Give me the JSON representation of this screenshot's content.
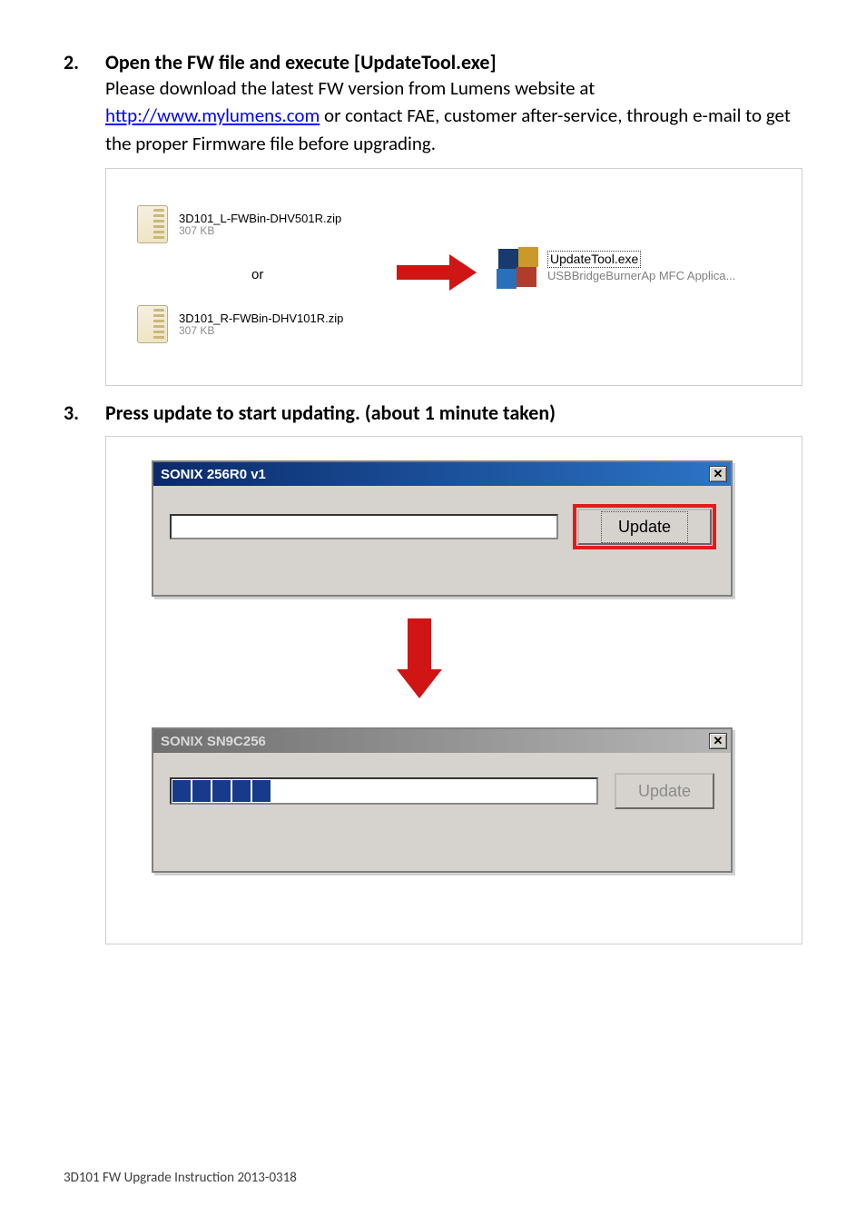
{
  "step2": {
    "num": "2.",
    "title": "Open the FW file and execute [UpdateTool.exe]",
    "body_pre": "Please download the latest FW version from Lumens website at ",
    "link": "http://www.mylumens.com",
    "body_post1": " or contact FAE, customer after-service, through e-mail to get the proper Firmware file before upgrading."
  },
  "fig1": {
    "zip1_name": "3D101_L-FWBin-DHV501R.zip",
    "zip1_size": "307 KB",
    "or": "or",
    "zip2_name": "3D101_R-FWBin-DHV101R.zip",
    "zip2_size": "307 KB",
    "app_line1": "UpdateTool.exe",
    "app_line2": "USBBridgeBurnerAp MFC Applica..."
  },
  "step3": {
    "num": "3.",
    "title": "Press update to start updating. (about 1 minute taken)"
  },
  "win1": {
    "title": "SONIX 256R0    v1",
    "button": "Update"
  },
  "win2": {
    "title": "SONIX SN9C256",
    "button": "Update"
  },
  "footer": "3D101 FW Upgrade Instruction 2013-0318"
}
